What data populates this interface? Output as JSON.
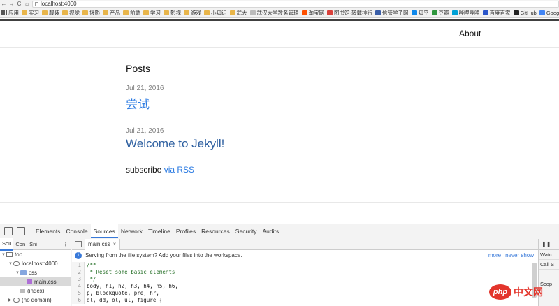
{
  "browser": {
    "url": "localhost:4000",
    "bookmarks": [
      {
        "label": "应用",
        "icon": "apps-icon",
        "kind": "apps"
      },
      {
        "label": "实习",
        "icon": "folder-icon",
        "kind": "folder"
      },
      {
        "label": "服装",
        "icon": "folder-icon",
        "kind": "folder"
      },
      {
        "label": "视觉",
        "icon": "folder-icon",
        "kind": "folder"
      },
      {
        "label": "摄影",
        "icon": "folder-icon",
        "kind": "folder"
      },
      {
        "label": "产品",
        "icon": "folder-icon",
        "kind": "folder"
      },
      {
        "label": "前端",
        "icon": "folder-icon",
        "kind": "folder"
      },
      {
        "label": "学习",
        "icon": "folder-icon",
        "kind": "folder"
      },
      {
        "label": "影视",
        "icon": "folder-icon",
        "kind": "folder"
      },
      {
        "label": "游戏",
        "icon": "folder-icon",
        "kind": "folder"
      },
      {
        "label": "小知识",
        "icon": "folder-icon",
        "kind": "folder"
      },
      {
        "label": "武大",
        "icon": "folder-icon",
        "kind": "folder"
      },
      {
        "label": "武汉大学教务管理",
        "icon": "site-icon",
        "kind": "site",
        "color": "#bbbbbb"
      },
      {
        "label": "淘宝网",
        "icon": "taobao-icon",
        "kind": "site",
        "color": "#ff5000"
      },
      {
        "label": "图书馆-转载排行",
        "icon": "site-icon",
        "kind": "site",
        "color": "#d9413b"
      },
      {
        "label": "信管学子网",
        "icon": "site-icon",
        "kind": "site",
        "color": "#3a5ea8"
      },
      {
        "label": "知乎",
        "icon": "zhihu-icon",
        "kind": "site",
        "color": "#0f88eb"
      },
      {
        "label": "豆瓣",
        "icon": "douban-icon",
        "kind": "site",
        "color": "#2e963d"
      },
      {
        "label": "哔哩哔哩",
        "icon": "bilibili-icon",
        "kind": "site",
        "color": "#00a1d6"
      },
      {
        "label": "百度百家",
        "icon": "site-icon",
        "kind": "site",
        "color": "#2a55c9"
      },
      {
        "label": "GitHub",
        "icon": "github-icon",
        "kind": "site",
        "color": "#222222"
      },
      {
        "label": "Google",
        "icon": "google-icon",
        "kind": "site",
        "color": "#4285f4"
      }
    ]
  },
  "site": {
    "nav_about": "About",
    "heading": "Posts",
    "posts": [
      {
        "date": "Jul 21, 2016",
        "title": "尝试"
      },
      {
        "date": "Jul 21, 2016",
        "title": "Welcome to Jekyll!"
      }
    ],
    "rss_prefix": "subscribe ",
    "rss_link": "via RSS"
  },
  "devtools": {
    "tabs": [
      "Elements",
      "Console",
      "Sources",
      "Network",
      "Timeline",
      "Profiles",
      "Resources",
      "Security",
      "Audits"
    ],
    "active_tab": "Sources",
    "nav_subtabs": [
      "Sou",
      "Con",
      "Sni"
    ],
    "tree": [
      {
        "label": "top",
        "indent": 0,
        "icon": "frame",
        "toggle": "▼"
      },
      {
        "label": "localhost:4000",
        "indent": 1,
        "icon": "cloud",
        "toggle": "▼"
      },
      {
        "label": "css",
        "indent": 2,
        "icon": "folder",
        "toggle": "▼"
      },
      {
        "label": "main.css",
        "indent": 3,
        "icon": "file",
        "toggle": "",
        "selected": true
      },
      {
        "label": "(index)",
        "indent": 2,
        "icon": "file-grey",
        "toggle": ""
      },
      {
        "label": "(no domain)",
        "indent": 1,
        "icon": "cloud",
        "toggle": "▶"
      }
    ],
    "editor_tab": "main.css",
    "infobar_text": "Serving from the file system? Add your files into the workspace.",
    "infobar_more": "more",
    "infobar_never": "never show",
    "code": [
      {
        "n": "1",
        "text": "/**",
        "comment": true
      },
      {
        "n": "2",
        "text": " * Reset some basic elements",
        "comment": true
      },
      {
        "n": "3",
        "text": " */",
        "comment": true
      },
      {
        "n": "4",
        "text": "body, h1, h2, h3, h4, h5, h6,",
        "comment": false
      },
      {
        "n": "5",
        "text": "p, blockquote, pre, hr,",
        "comment": false
      },
      {
        "n": "6",
        "text": "dl, dd, ol, ul, figure {",
        "comment": false
      }
    ],
    "right_sections": [
      "Watc",
      "Call S",
      "Scop"
    ]
  },
  "watermark": {
    "logo": "php",
    "text": "中文网"
  }
}
